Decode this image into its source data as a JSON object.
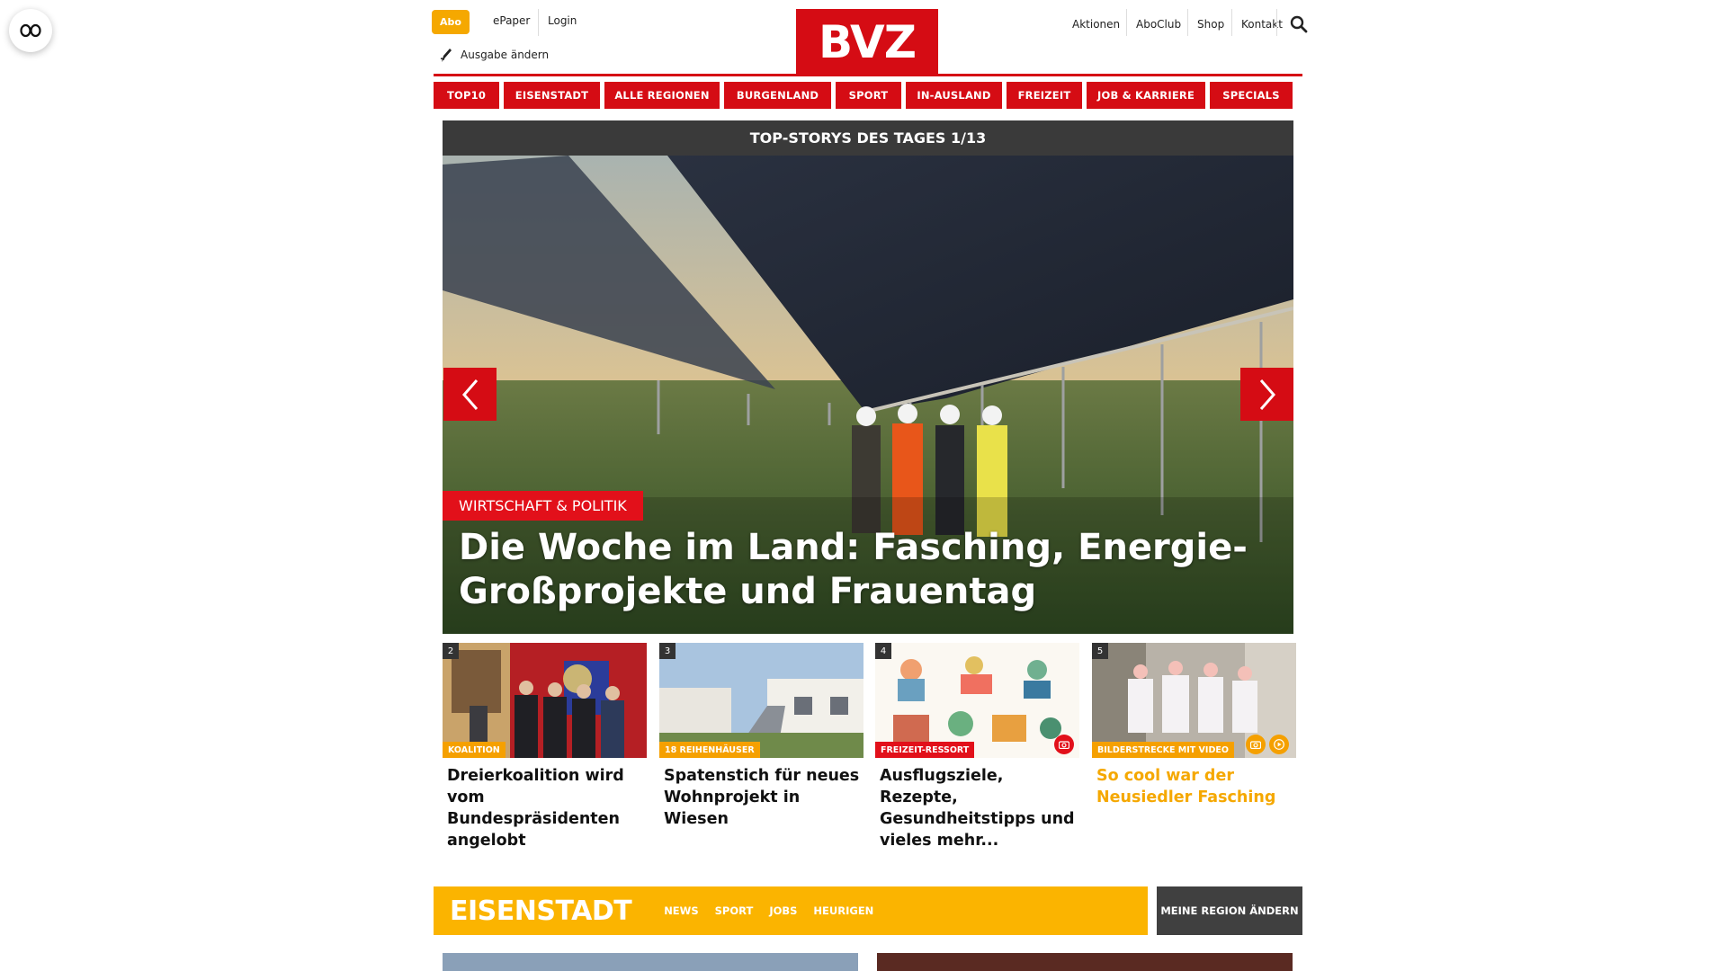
{
  "header": {
    "abo_label": "Abo",
    "epaper_label": "ePaper",
    "login_label": "Login",
    "edition_label": "Ausgabe ändern",
    "logo_text": "BVZ",
    "right_links": [
      "Aktionen",
      "AboClub",
      "Shop",
      "Kontakt"
    ]
  },
  "nav": {
    "items": [
      "TOP10",
      "EISENSTADT",
      "ALLE REGIONEN",
      "BURGENLAND",
      "SPORT",
      "IN-AUSLAND",
      "FREIZEIT",
      "JOB & KARRIERE",
      "SPECIALS"
    ]
  },
  "hero": {
    "heading": "TOP-STORYS DES TAGES 1/13",
    "category": "WIRTSCHAFT & POLITIK",
    "title": "Die Woche im Land: Fasching, Energie-Großprojekte und Frauentag"
  },
  "teasers": [
    {
      "number": "2",
      "label": "KOALITION",
      "title": "Dreierkoalition wird vom Bundespräsidenten angelobt"
    },
    {
      "number": "3",
      "label": "18 REIHENHÄUSER",
      "title": "Spatenstich für neues Wohnprojekt in Wiesen"
    },
    {
      "number": "4",
      "label": "FREIZEIT-RESSORT",
      "title": "Ausflugsziele, Rezepte, Gesundheitstipps und vieles mehr..."
    },
    {
      "number": "5",
      "label": "BILDERSTRECKE MIT VIDEO",
      "title": "So cool war der Neusiedler Fasching"
    }
  ],
  "region": {
    "title": "EISENSTADT",
    "links": [
      "NEWS",
      "SPORT",
      "JOBS",
      "HEURIGEN"
    ],
    "change_label": "MEINE REGION ÄNDERN"
  },
  "colors": {
    "brand_red": "#d50c14",
    "abo_orange": "#f5a800",
    "region_yellow": "#fbb400",
    "dark_gray": "#404040"
  },
  "icons": [
    "reader-mode-icon",
    "pen-icon",
    "search-icon",
    "arrow-left-icon",
    "arrow-right-icon",
    "camera-icon",
    "video-play-icon"
  ]
}
